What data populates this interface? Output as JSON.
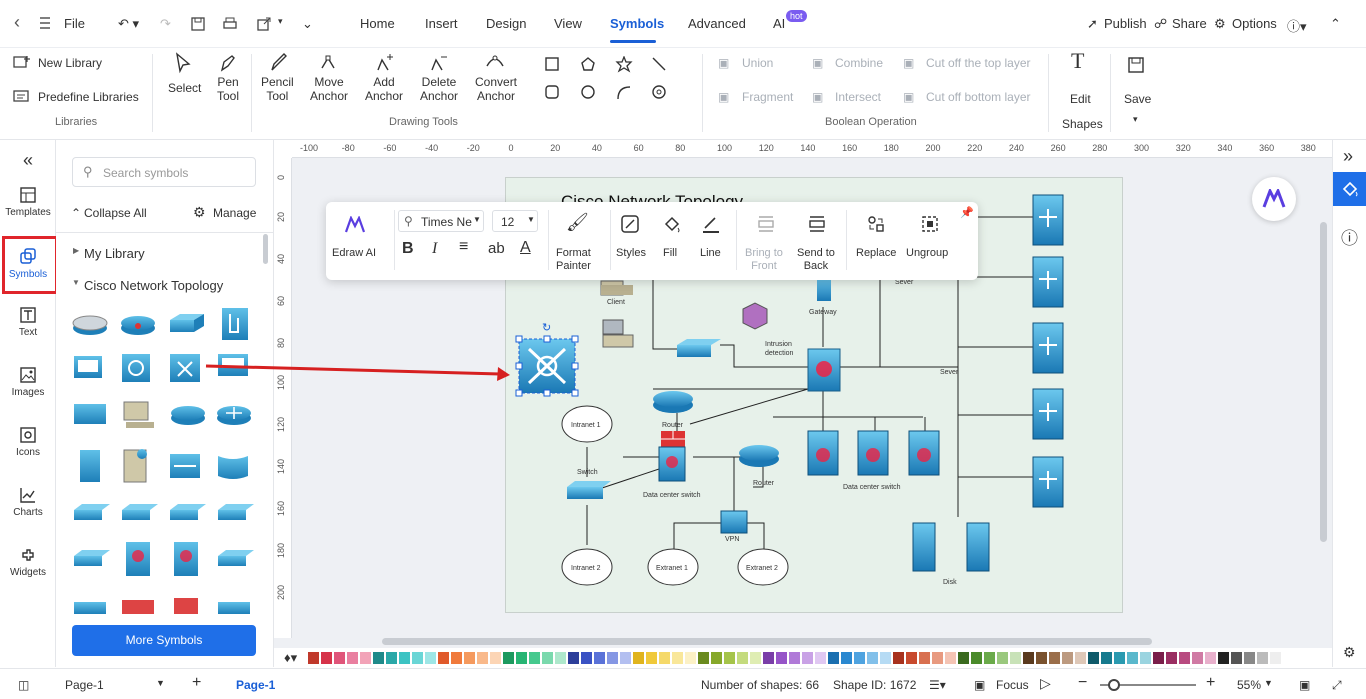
{
  "titlebar": {
    "file_label": "File",
    "tabs": [
      "Home",
      "Insert",
      "Design",
      "View",
      "Symbols",
      "Advanced",
      "AI"
    ],
    "hot_badge": "hot",
    "publish": "Publish",
    "share": "Share",
    "options": "Options"
  },
  "ribbon": {
    "libraries": {
      "new_library": "New Library",
      "predefine": "Predefine Libraries",
      "group": "Libraries"
    },
    "drawing_tools": {
      "select": "Select",
      "pen": [
        "Pen",
        "Tool"
      ],
      "pencil": [
        "Pencil",
        "Tool"
      ],
      "move_anchor": [
        "Move",
        "Anchor"
      ],
      "add_anchor": [
        "Add",
        "Anchor"
      ],
      "delete_anchor": [
        "Delete",
        "Anchor"
      ],
      "convert_anchor": [
        "Convert",
        "Anchor"
      ],
      "group": "Drawing Tools"
    },
    "boolean": {
      "union": "Union",
      "combine": "Combine",
      "cut_top": "Cut off the top layer",
      "fragment": "Fragment",
      "intersect": "Intersect",
      "cut_bottom": "Cut off bottom layer",
      "group": "Boolean Operation"
    },
    "edit_shapes": {
      "edit": "Edit",
      "shapes": "Shapes"
    },
    "save": "Save"
  },
  "left_rail": [
    "Templates",
    "Symbols",
    "Text",
    "Images",
    "Icons",
    "Charts",
    "Widgets"
  ],
  "library": {
    "search_placeholder": "Search symbols",
    "collapse_all": "Collapse All",
    "manage": "Manage",
    "my_library": "My Library",
    "category": "Cisco Network Topology",
    "more_symbols": "More Symbols"
  },
  "rulers": {
    "h": [
      "-100",
      "-80",
      "-60",
      "-40",
      "-20",
      "0",
      "20",
      "40",
      "60",
      "80",
      "100",
      "120",
      "140",
      "160",
      "180",
      "200",
      "220",
      "240",
      "260",
      "280",
      "300",
      "320",
      "340",
      "360",
      "380"
    ],
    "v": [
      "0",
      "20",
      "40",
      "60",
      "80",
      "100",
      "120",
      "140",
      "160",
      "180",
      "200"
    ]
  },
  "diagram": {
    "title": "Cisco Network Topology",
    "labels": {
      "client": "Client",
      "gateway": "Gateway",
      "intrusion": [
        "Intrusion",
        "detection"
      ],
      "server_top": "Sever",
      "server": "Sever",
      "intranet1": "Intranet 1",
      "router1": "Router",
      "switch": "Switch",
      "dc_switch": "Data center switch",
      "router2": "Router",
      "dc_switch2": "Data center switch",
      "vpn": "VPN",
      "intranet2": "Intranet 2",
      "extranet1": "Extranet 1",
      "extranet2": "Extranet 2",
      "disk": "Disk"
    }
  },
  "float_toolbar": {
    "edraw_ai": "Edraw AI",
    "font": "Times Ne",
    "size": "12",
    "format_painter": [
      "Format",
      "Painter"
    ],
    "styles": "Styles",
    "fill": "Fill",
    "line": "Line",
    "bring_front": [
      "Bring to",
      "Front"
    ],
    "send_back": [
      "Send to",
      "Back"
    ],
    "replace": "Replace",
    "ungroup": "Ungroup"
  },
  "status": {
    "page_select": "Page-1",
    "page_tab": "Page-1",
    "shapes": "Number of shapes: 66",
    "shape_id": "Shape ID: 1672",
    "focus": "Focus",
    "zoom": "55%"
  },
  "palette": [
    "#c0392b",
    "#d6334a",
    "#e0557a",
    "#e97fa0",
    "#f2a3b8",
    "#1f8a8a",
    "#2aa8a8",
    "#3cc3c3",
    "#6ad6d6",
    "#9ee6e6",
    "#e05a2b",
    "#f07a3c",
    "#f59a5e",
    "#f9b98b",
    "#fcd5b5",
    "#1d9a5f",
    "#27b574",
    "#45c98e",
    "#7ad9ad",
    "#aee8cc",
    "#2c3e9a",
    "#3a52c4",
    "#5a72d8",
    "#8597e4",
    "#b3bff0",
    "#e0b41e",
    "#f0c93a",
    "#f5d96a",
    "#f9e79a",
    "#fcf1c6",
    "#6a8a1e",
    "#86a82a",
    "#a5c44a",
    "#c4db7e",
    "#dfedb3",
    "#7a3ea8",
    "#9654c8",
    "#b07ad8",
    "#c9a2e6",
    "#e0c8f2",
    "#1a6fb0",
    "#2a88d0",
    "#4fa3e0",
    "#82c0ea",
    "#b6dbf4",
    "#a8321e",
    "#c84a2e",
    "#d87050",
    "#e89a80",
    "#f4c4b4",
    "#3a6a1e",
    "#4a8a2a",
    "#6aaa4a",
    "#9ac87e",
    "#c8e2b8",
    "#5a3a1e",
    "#7a522e",
    "#9a6e4a",
    "#bc9a80",
    "#dec8b8",
    "#0e5a6a",
    "#167a8e",
    "#2a9ab0",
    "#5ab8cc",
    "#9ad4e0",
    "#7a1e4a",
    "#9a2e62",
    "#b84a80",
    "#d07aa4",
    "#e8b0cc",
    "#222222",
    "#555555",
    "#888888",
    "#bbbbbb",
    "#eeeeee"
  ]
}
